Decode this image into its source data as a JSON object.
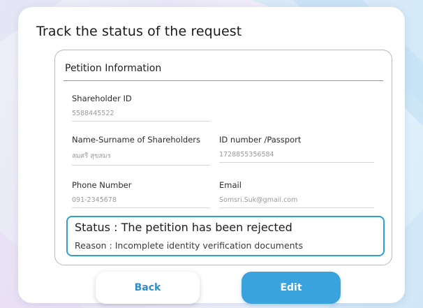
{
  "page": {
    "title": "Track the status of the request"
  },
  "panel": {
    "title": "Petition Information",
    "fields": [
      {
        "label": "Shareholder ID",
        "value": "5588445522"
      },
      {
        "label": "Name-Surname of Shareholders",
        "value": "สมศรี สุขสมร"
      },
      {
        "label": "ID number /Passport",
        "value": "1728855356584"
      },
      {
        "label": "Phone Number",
        "value": "091-2345678"
      },
      {
        "label": "Email",
        "value": "Somsri.Suk@gmail.com"
      }
    ]
  },
  "status": {
    "status_label": "Status :",
    "status_text": "The petition has been rejected",
    "reason_label": "Reason :",
    "reason_text": "Incomplete identity verification documents",
    "accent_color": "#2e9ed3"
  },
  "actions": {
    "back_label": "Back",
    "edit_label": "Edit",
    "primary_color": "#3aa2dc"
  }
}
